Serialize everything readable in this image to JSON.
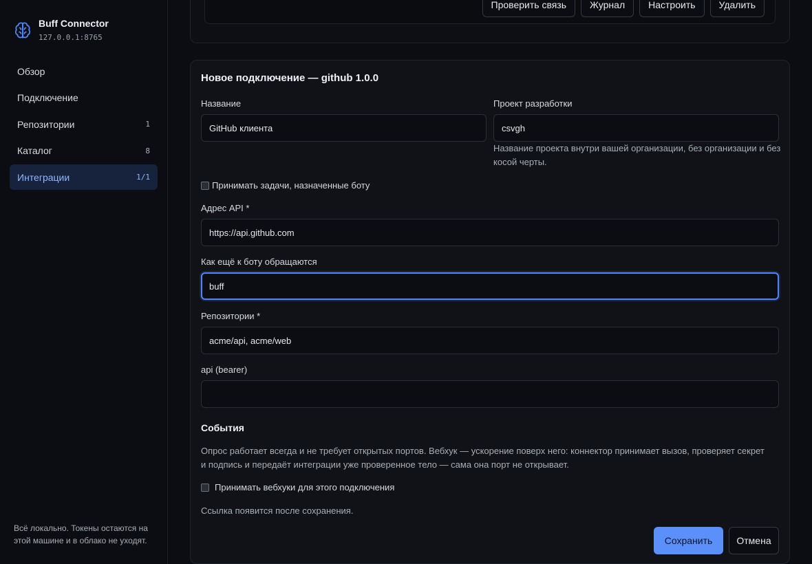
{
  "brand": {
    "name": "Buff Connector",
    "address": "127.0.0.1:8765",
    "logo_icon": "brain-icon",
    "accent": "#4f86f7"
  },
  "nav": {
    "items": [
      {
        "label": "Обзор",
        "count": ""
      },
      {
        "label": "Подключение",
        "count": ""
      },
      {
        "label": "Репозитории",
        "count": "1"
      },
      {
        "label": "Каталог",
        "count": "8"
      },
      {
        "label": "Интеграции",
        "count": "1/1",
        "active": true
      }
    ]
  },
  "sidebar_footer": "Всё локально. Токены остаются на этой машине и в облако не уходят.",
  "top_card": {
    "buttons": [
      "Проверить связь",
      "Журнал",
      "Настроить",
      "Удалить"
    ]
  },
  "form": {
    "title": "Новое подключение — github 1.0.0",
    "name_label": "Название",
    "name_value": "GitHub клиента",
    "project_label": "Проект разработки",
    "project_value": "csvgh",
    "project_hint": "Название проекта внутри вашей организации, без организации и без косой черты.",
    "bot_tasks_label": "Принимать задачи, назначенные боту",
    "api_label": "Адрес API *",
    "api_value": "https://api.github.com",
    "aliases_label": "Как ещё к боту обращаются",
    "aliases_value": "buff",
    "repos_label": "Репозитории *",
    "repos_value": "acme/api, acme/web",
    "bearer_label": "api (bearer)",
    "bearer_value": "",
    "events_title": "События",
    "events_desc": "Опрос работает всегда и не требует открытых портов. Вебхук — ускорение поверх него: коннектор принимает вызов, проверяет секрет и подпись и передаёт интеграции уже проверенное тело — сама она порт не открывает.",
    "webhook_label": "Принимать вебхуки для этого подключения",
    "link_note": "Ссылка появится после сохранения.",
    "save_label": "Сохранить",
    "cancel_label": "Отмена"
  }
}
